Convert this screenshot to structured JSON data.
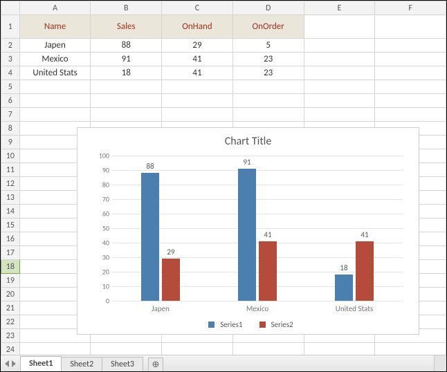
{
  "columns": [
    "A",
    "B",
    "C",
    "D",
    "E",
    "F"
  ],
  "table": {
    "headers": [
      "Name",
      "Sales",
      "OnHand",
      "OnOrder"
    ],
    "rows": [
      {
        "name": "Japen",
        "sales": "88",
        "onhand": "29",
        "onorder": "5"
      },
      {
        "name": "Mexico",
        "sales": "91",
        "onhand": "41",
        "onorder": "23"
      },
      {
        "name": "United Stats",
        "sales": "18",
        "onhand": "41",
        "onorder": "23"
      }
    ]
  },
  "chart_data": {
    "type": "bar",
    "title": "Chart Title",
    "categories": [
      "Japen",
      "Mexico",
      "United Stats"
    ],
    "series": [
      {
        "name": "Series1",
        "values": [
          88,
          91,
          18
        ]
      },
      {
        "name": "Series2",
        "values": [
          29,
          41,
          41
        ]
      }
    ],
    "ylim": [
      0,
      100
    ],
    "yticks": [
      0,
      10,
      20,
      30,
      40,
      50,
      60,
      70,
      80,
      90,
      100
    ],
    "xlabel": "",
    "ylabel": ""
  },
  "tabs": {
    "items": [
      "Sheet1",
      "Sheet2",
      "Sheet3"
    ],
    "active": "Sheet1"
  },
  "selected_row": 18,
  "visible_rows": 24
}
